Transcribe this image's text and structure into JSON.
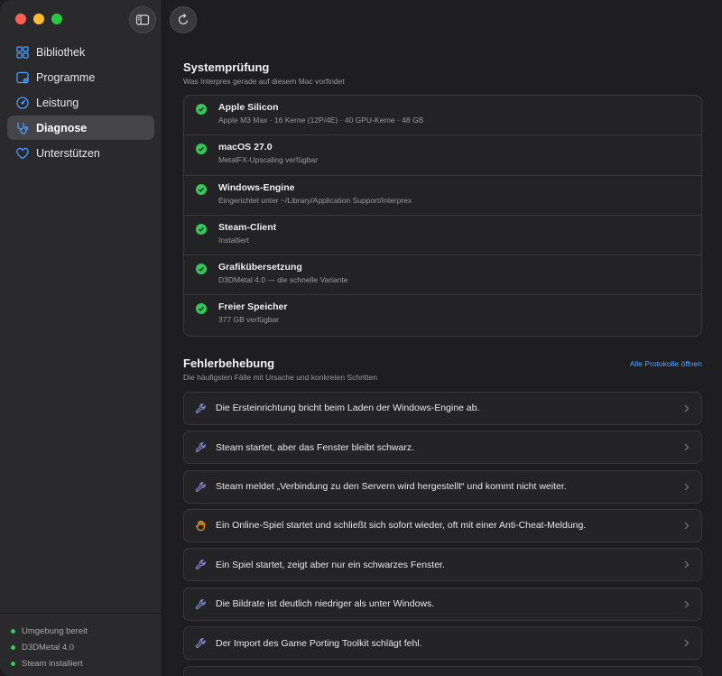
{
  "colors": {
    "accent": "#5aa2ff",
    "success": "#34c759",
    "warning": "#ff9f0a",
    "background": "#1e1e20",
    "sidebar": "#2a2a2d"
  },
  "sidebar": {
    "items": [
      {
        "label": "Bibliothek",
        "icon": "grid-icon",
        "active": false
      },
      {
        "label": "Programme",
        "icon": "window-icon",
        "active": false
      },
      {
        "label": "Leistung",
        "icon": "gauge-icon",
        "active": false
      },
      {
        "label": "Diagnose",
        "icon": "stethoscope-icon",
        "active": true
      },
      {
        "label": "Unterstützen",
        "icon": "heart-icon",
        "active": false
      }
    ],
    "status": [
      {
        "label": "Umgebung bereit"
      },
      {
        "label": "D3DMetal 4.0"
      },
      {
        "label": "Steam installiert"
      }
    ]
  },
  "toolbar": {
    "sidebar_toggle_icon": "sidebar-icon",
    "refresh_icon": "refresh-icon"
  },
  "system_check": {
    "title": "Systemprüfung",
    "subtitle": "Was Interprex gerade auf diesem Mac vorfindet",
    "items": [
      {
        "title": "Apple Silicon",
        "detail": "Apple M3 Max · 16 Kerne (12P/4E) · 40 GPU-Kerne · 48 GB"
      },
      {
        "title": "macOS 27.0",
        "detail": "MetalFX-Upscaling verfügbar"
      },
      {
        "title": "Windows-Engine",
        "detail": "Eingerichtet unter ~/Library/Application Support/Interprex"
      },
      {
        "title": "Steam-Client",
        "detail": "Installiert"
      },
      {
        "title": "Grafikübersetzung",
        "detail": "D3DMetal 4.0 — die schnelle Variante"
      },
      {
        "title": "Freier Speicher",
        "detail": "377 GB verfügbar"
      }
    ]
  },
  "troubleshooting": {
    "title": "Fehlerbehebung",
    "subtitle": "Die häufigsten Fälle mit Ursache und konkreten Schritten",
    "link": "Alle Protokolle öffnen",
    "items": [
      {
        "text": "Die Ersteinrichtung bricht beim Laden der Windows-Engine ab.",
        "icon": "wrench-icon"
      },
      {
        "text": "Steam startet, aber das Fenster bleibt schwarz.",
        "icon": "wrench-icon"
      },
      {
        "text": "Steam meldet „Verbindung zu den Servern wird hergestellt“ und kommt nicht weiter.",
        "icon": "wrench-icon"
      },
      {
        "text": "Ein Online-Spiel startet und schließt sich sofort wieder, oft mit einer Anti-Cheat-Meldung.",
        "icon": "hand-icon"
      },
      {
        "text": "Ein Spiel startet, zeigt aber nur ein schwarzes Fenster.",
        "icon": "wrench-icon"
      },
      {
        "text": "Die Bildrate ist deutlich niedriger als unter Windows.",
        "icon": "wrench-icon"
      },
      {
        "text": "Der Import des Game Porting Toolkit schlägt fehl.",
        "icon": "wrench-icon"
      },
      {
        "text": "",
        "icon": "wrench-icon"
      }
    ]
  }
}
